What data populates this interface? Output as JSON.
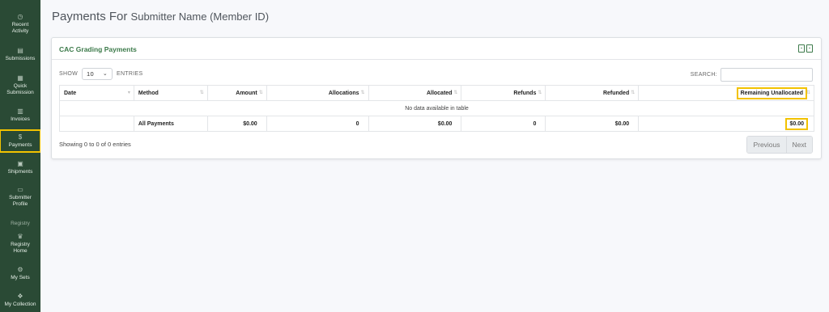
{
  "sidebar": {
    "items": [
      {
        "label_1": "Recent",
        "label_2": "Activity",
        "icon": "clock-icon"
      },
      {
        "label_1": "Submissions",
        "icon": "file-icon"
      },
      {
        "label_1": "Quick",
        "label_2": "Submission",
        "icon": "lightning-icon"
      },
      {
        "label_1": "Invoices",
        "icon": "receipt-icon"
      },
      {
        "label_1": "Payments",
        "icon": "dollar-icon"
      },
      {
        "label_1": "Shipments",
        "icon": "box-icon"
      },
      {
        "label_1": "Submitter",
        "label_2": "Profile",
        "icon": "id-card-icon"
      },
      {
        "label_1": "Registry",
        "label_2": "Home",
        "icon": "trophy-icon"
      },
      {
        "label_1": "My Sets",
        "icon": "sets-icon"
      },
      {
        "label_1": "My Collection",
        "icon": "collection-icon"
      }
    ],
    "section_registry": "Registry",
    "active": "Payments"
  },
  "page": {
    "title_prefix": "Payments For",
    "title_name": "Submitter Name (Member ID)"
  },
  "card": {
    "title": "CAC Grading Payments",
    "export_icons": [
      "export-pdf-icon",
      "export-excel-icon"
    ]
  },
  "controls": {
    "show_label": "SHOW",
    "show_value": "10",
    "entries_label": "ENTRIES",
    "search_label": "SEARCH:",
    "search_value": ""
  },
  "table": {
    "columns": [
      "Date",
      "Method",
      "Amount",
      "Allocations",
      "Allocated",
      "Refunds",
      "Refunded",
      "Remaining Unallocated"
    ],
    "empty_message": "No data available in table",
    "totals": {
      "date": "",
      "method": "All Payments",
      "amount": "$0.00",
      "allocations": "0",
      "allocated": "$0.00",
      "refunds": "0",
      "refunded": "$0.00",
      "remaining": "$0.00"
    }
  },
  "footer": {
    "info": "Showing 0 to 0 of 0 entries",
    "previous": "Previous",
    "next": "Next"
  },
  "colors": {
    "sidebar_bg": "#2a4a35",
    "accent_green": "#3c7a4a",
    "highlight_yellow": "#f2c200"
  }
}
